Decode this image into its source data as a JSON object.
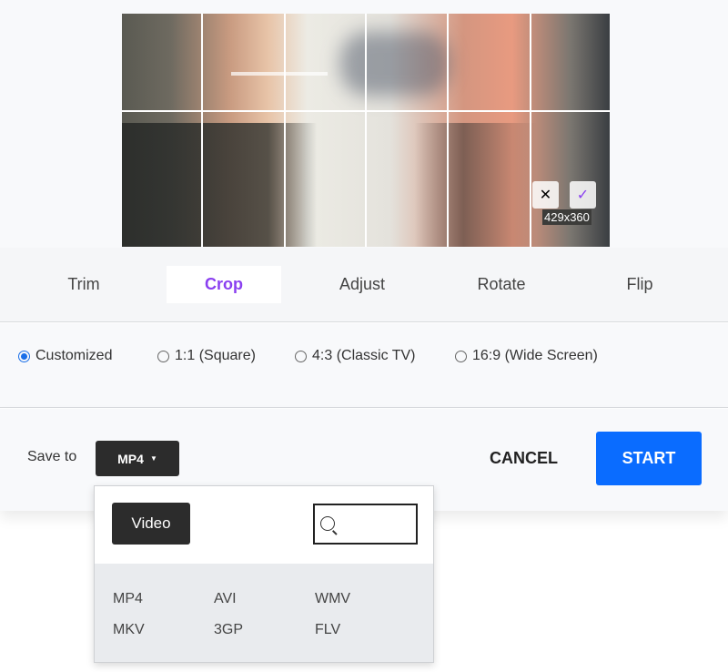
{
  "crop": {
    "size_label": "429x360",
    "cancel_icon": "close-icon",
    "confirm_icon": "check-icon",
    "accent": "#8a3ff0"
  },
  "tabs": [
    {
      "label": "Trim"
    },
    {
      "label": "Crop",
      "active": true
    },
    {
      "label": "Adjust"
    },
    {
      "label": "Rotate"
    },
    {
      "label": "Flip"
    }
  ],
  "ratios": [
    {
      "label": "Customized",
      "selected": true
    },
    {
      "label": "1:1 (Square)"
    },
    {
      "label": "4:3 (Classic TV)"
    },
    {
      "label": "16:9 (Wide Screen)"
    }
  ],
  "save": {
    "label": "Save to",
    "format": "MP4",
    "cancel": "CANCEL",
    "start": "START",
    "start_color": "#0a6cff"
  },
  "dropdown": {
    "category": "Video",
    "search_placeholder": "",
    "formats": [
      "MP4",
      "AVI",
      "WMV",
      "MKV",
      "3GP",
      "FLV"
    ]
  }
}
